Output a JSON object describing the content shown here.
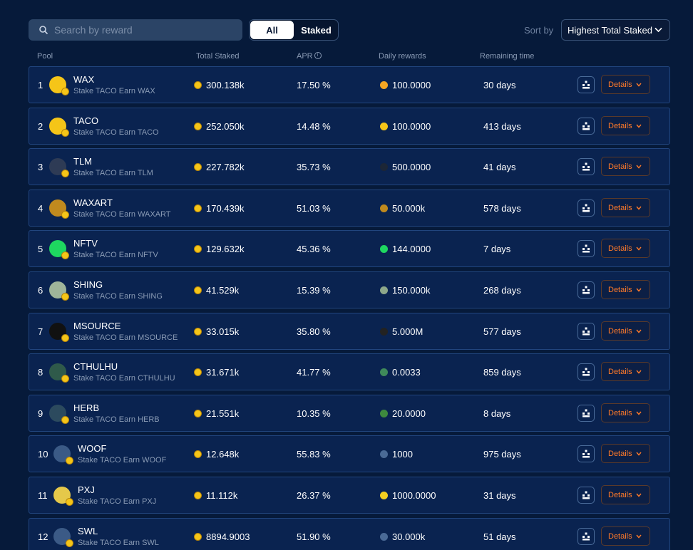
{
  "search": {
    "placeholder": "Search by reward",
    "icon": "search-icon"
  },
  "filter": {
    "all_label": "All",
    "staked_label": "Staked",
    "selected": "All"
  },
  "sort": {
    "label": "Sort by",
    "value": "Highest Total Staked"
  },
  "columns": {
    "pool": "Pool",
    "total_staked": "Total Staked",
    "apr": "APR",
    "daily_rewards": "Daily rewards",
    "remaining_time": "Remaining time"
  },
  "details_label": "Details",
  "colors": {
    "accent": "#ff7a29",
    "background": "#061a3a",
    "row": "#0a2350"
  },
  "pools": [
    {
      "index": "1",
      "name": "WAX",
      "sub": "Stake TACO Earn WAX",
      "total": "300.138k",
      "apr": "17.50 %",
      "daily": "100.0000",
      "remaining": "30 days",
      "logo_color": "#f5c518",
      "reward_color": "#f5a623"
    },
    {
      "index": "2",
      "name": "TACO",
      "sub": "Stake TACO Earn TACO",
      "total": "252.050k",
      "apr": "14.48 %",
      "daily": "100.0000",
      "remaining": "413 days",
      "logo_color": "#f5c518",
      "reward_color": "#f5c518"
    },
    {
      "index": "3",
      "name": "TLM",
      "sub": "Stake TACO Earn TLM",
      "total": "227.782k",
      "apr": "35.73 %",
      "daily": "500.0000",
      "remaining": "41 days",
      "logo_color": "#2e3b55",
      "reward_color": "#1c2636"
    },
    {
      "index": "4",
      "name": "WAXART",
      "sub": "Stake TACO Earn WAXART",
      "total": "170.439k",
      "apr": "51.03 %",
      "daily": "50.000k",
      "remaining": "578 days",
      "logo_color": "#c08a1e",
      "reward_color": "#c08a1e"
    },
    {
      "index": "5",
      "name": "NFTV",
      "sub": "Stake TACO Earn NFTV",
      "total": "129.632k",
      "apr": "45.36 %",
      "daily": "144.0000",
      "remaining": "7 days",
      "logo_color": "#1ed760",
      "reward_color": "#1ed760"
    },
    {
      "index": "6",
      "name": "SHING",
      "sub": "Stake TACO Earn SHING",
      "total": "41.529k",
      "apr": "15.39 %",
      "daily": "150.000k",
      "remaining": "268 days",
      "logo_color": "#9fb59a",
      "reward_color": "#8ea88a"
    },
    {
      "index": "7",
      "name": "MSOURCE",
      "sub": "Stake TACO Earn MSOURCE",
      "total": "33.015k",
      "apr": "35.80 %",
      "daily": "5.000M",
      "remaining": "577 days",
      "logo_color": "#111111",
      "reward_color": "#222222"
    },
    {
      "index": "8",
      "name": "CTHULHU",
      "sub": "Stake TACO Earn CTHULHU",
      "total": "31.671k",
      "apr": "41.77 %",
      "daily": "0.0033",
      "remaining": "859 days",
      "logo_color": "#2f5a4a",
      "reward_color": "#3f8a5a"
    },
    {
      "index": "9",
      "name": "HERB",
      "sub": "Stake TACO Earn HERB",
      "total": "21.551k",
      "apr": "10.35 %",
      "daily": "20.0000",
      "remaining": "8 days",
      "logo_color": "#2c4a5e",
      "reward_color": "#3e8a3e"
    },
    {
      "index": "10",
      "name": "WOOF",
      "sub": "Stake TACO Earn WOOF",
      "total": "12.648k",
      "apr": "55.83 %",
      "daily": "1000",
      "remaining": "975 days",
      "logo_color": "#3b5a86",
      "reward_color": "#4a6a96"
    },
    {
      "index": "11",
      "name": "PXJ",
      "sub": "Stake TACO Earn PXJ",
      "total": "11.112k",
      "apr": "26.37 %",
      "daily": "1000.0000",
      "remaining": "31 days",
      "logo_color": "#e5c84a",
      "reward_color": "#f5d020"
    },
    {
      "index": "12",
      "name": "SWL",
      "sub": "Stake TACO Earn SWL",
      "total": "8894.9003",
      "apr": "51.90 %",
      "daily": "30.000k",
      "remaining": "51 days",
      "logo_color": "#3b5a86",
      "reward_color": "#4a6a96"
    }
  ]
}
